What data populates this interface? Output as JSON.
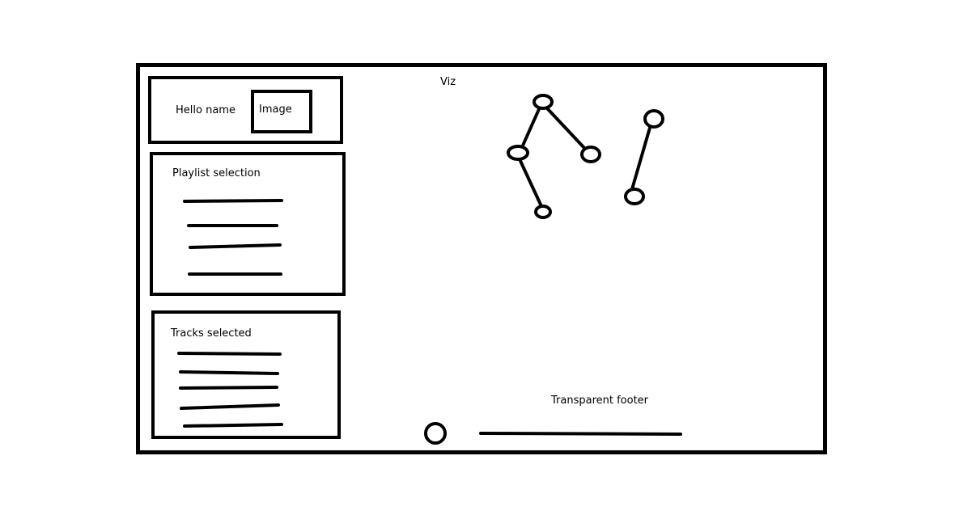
{
  "header": {
    "greeting": "Hello name",
    "image_label": "Image"
  },
  "playlist": {
    "title": "Playlist selection",
    "item_count": 4
  },
  "tracks": {
    "title": "Tracks selected",
    "item_count": 5
  },
  "viz": {
    "title": "Viz"
  },
  "footer": {
    "label": "Transparent footer"
  }
}
